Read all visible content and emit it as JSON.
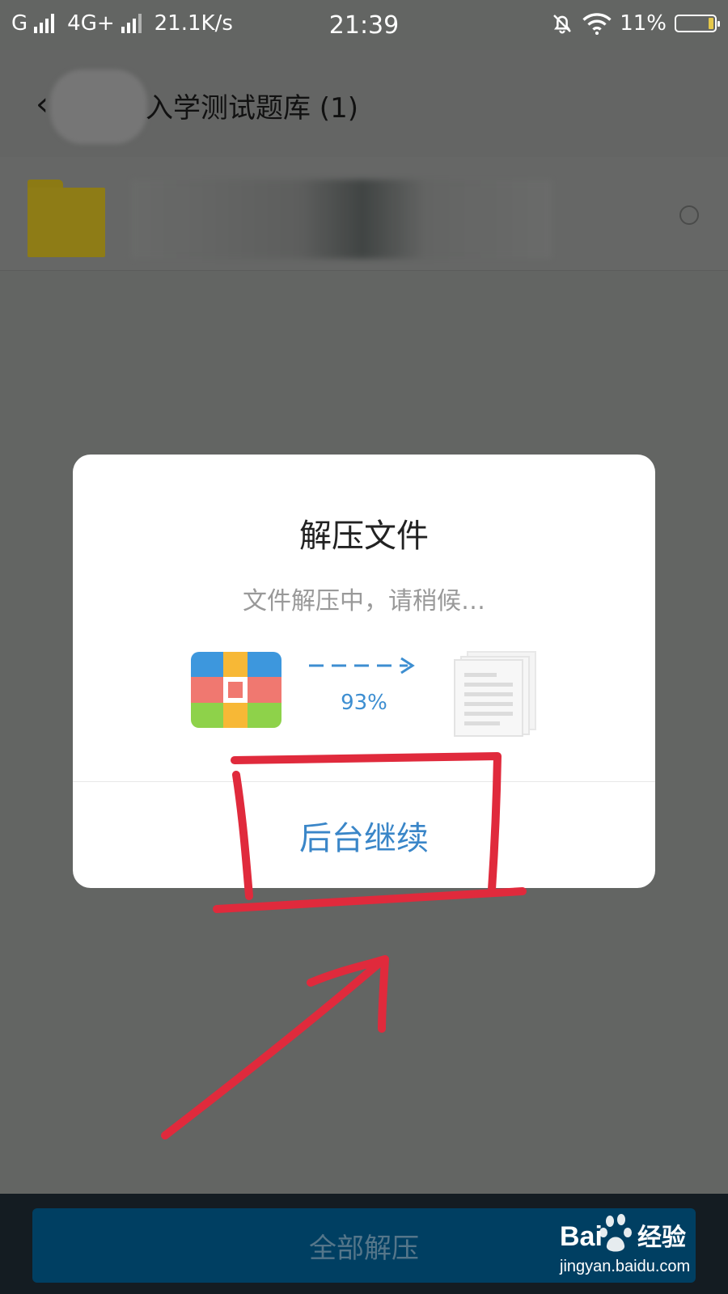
{
  "status_bar": {
    "carrier1": "G",
    "carrier2": "4G+",
    "speed": "21.1K/s",
    "time": "21:39",
    "battery": "11%",
    "battery_level": 0.11,
    "icons": [
      "signal-icon",
      "mute-bell-icon",
      "wifi-icon",
      "battery-icon"
    ]
  },
  "header": {
    "title": "入学测试题库 (1)",
    "back_icon": "back-chevron-icon"
  },
  "file_list": {
    "items": [
      {
        "icon": "folder-icon",
        "selected": false
      }
    ]
  },
  "dialog": {
    "title": "解压文件",
    "message": "文件解压中，请稍候…",
    "progress_label": "93%",
    "progress": 0.93,
    "button_label": "后台继续"
  },
  "bottom": {
    "extract_all_label": "全部解压"
  },
  "watermark": {
    "brand": "Bai",
    "brand_suffix": "经验",
    "url": "jingyan.baidu.com"
  },
  "colors": {
    "accent": "#3a86c8",
    "overlay": "#636563",
    "annotation": "#e02a3c",
    "folder": "#8e7c16"
  }
}
